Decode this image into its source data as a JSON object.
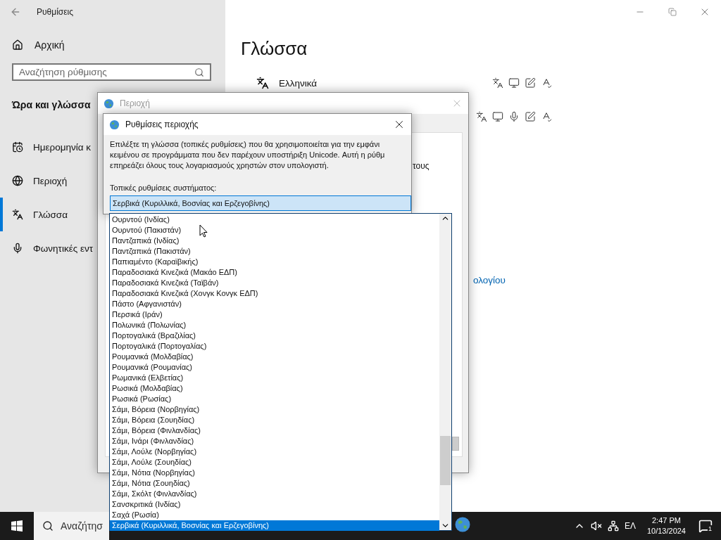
{
  "settings_window": {
    "title": "Ρυθμίσεις",
    "home": "Αρχική",
    "search": {
      "placeholder": "Αναζήτηση ρύθμισης"
    },
    "section": "Ώρα και γλώσσα",
    "nav": [
      {
        "kind": "calendar",
        "label": "Ημερομηνία κ",
        "selected": false
      },
      {
        "kind": "globe",
        "label": "Περιοχή",
        "selected": false
      },
      {
        "kind": "language",
        "label": "Γλώσσα",
        "selected": true
      },
      {
        "kind": "microphone",
        "label": "Φωνητικές εντ",
        "selected": false
      }
    ],
    "heading": "Γλώσσα",
    "languages": [
      {
        "name": "Ελληνικά",
        "features": [
          {
            "kind": "text"
          },
          {
            "kind": "display"
          },
          {
            "kind": "handwriting"
          },
          {
            "kind": "spelling"
          }
        ]
      },
      {
        "features": [
          {
            "kind": "text"
          },
          {
            "kind": "display"
          },
          {
            "kind": "speech"
          },
          {
            "kind": "handwriting"
          },
          {
            "kind": "spelling"
          }
        ]
      }
    ],
    "link": "ολογίου"
  },
  "region_dialog": {
    "title": "Περιοχή",
    "fragment": "τους"
  },
  "region_settings_dialog": {
    "title": "Ρυθμίσεις περιοχής",
    "description_lines": [
      "Επιλέξτε τη γλώσσα (τοπικές ρυθμίσεις) που θα χρησιμοποιείται για την εμφάνι",
      "κειμένου σε προγράμματα που δεν παρέχουν υποστήριξη Unicode. Αυτή η ρύθμ",
      "επηρεάζει όλους τους λογαριασμούς χρηστών στον υπολογιστή."
    ],
    "locale_label": "Τοπικές ρυθμίσεις συστήματος:",
    "locale_value": "Σερβικά (Κυριλλικά, Βοσνίας και Ερζεγοβίνης)"
  },
  "locale_list": {
    "items": [
      {
        "label": "Ουρντού (Ινδίας)",
        "selected": false
      },
      {
        "label": "Ουρντού (Πακιστάν)",
        "selected": false
      },
      {
        "label": "Παντζαπικά (Ινδίας)",
        "selected": false
      },
      {
        "label": "Παντζαπικά (Πακιστάν)",
        "selected": false
      },
      {
        "label": "Παπιαμέντο (Καραϊβικής)",
        "selected": false
      },
      {
        "label": "Παραδοσιακά Κινεζικά (Μακάο ΕΔΠ)",
        "selected": false
      },
      {
        "label": "Παραδοσιακά Κινεζικά (Ταϊβάν)",
        "selected": false
      },
      {
        "label": "Παραδοσιακά Κινεζικά (Χονγκ Κονγκ ΕΔΠ)",
        "selected": false
      },
      {
        "label": "Πάστο (Αφγανιστάν)",
        "selected": false
      },
      {
        "label": "Περσικά (Ιράν)",
        "selected": false
      },
      {
        "label": "Πολωνικά (Πολωνίας)",
        "selected": false
      },
      {
        "label": "Πορτογαλικά (Βραζιλίας)",
        "selected": false
      },
      {
        "label": "Πορτογαλικά (Πορτογαλίας)",
        "selected": false
      },
      {
        "label": "Ρουμανικά (Μολδαβίας)",
        "selected": false
      },
      {
        "label": "Ρουμανικά (Ρουμανίας)",
        "selected": false
      },
      {
        "label": "Ρωμανικά (Ελβετίας)",
        "selected": false
      },
      {
        "label": "Ρωσικά (Μολδαβίας)",
        "selected": false
      },
      {
        "label": "Ρωσικά (Ρωσίας)",
        "selected": false
      },
      {
        "label": "Σάμι, Βόρεια (Νορβηγίας)",
        "selected": false
      },
      {
        "label": "Σάμι, Βόρεια (Σουηδίας)",
        "selected": false
      },
      {
        "label": "Σάμι, Βόρεια (Φινλανδίας)",
        "selected": false
      },
      {
        "label": "Σάμι, Ινάρι (Φινλανδίας)",
        "selected": false
      },
      {
        "label": "Σάμι, Λούλε (Νορβηγίας)",
        "selected": false
      },
      {
        "label": "Σάμι, Λούλε (Σουηδίας)",
        "selected": false
      },
      {
        "label": "Σάμι, Νότια (Νορβηγίας)",
        "selected": false
      },
      {
        "label": "Σάμι, Νότια (Σουηδίας)",
        "selected": false
      },
      {
        "label": "Σάμι, Σκόλτ (Φινλανδίας)",
        "selected": false
      },
      {
        "label": "Σανσκριτικά (Ινδίας)",
        "selected": false
      },
      {
        "label": "Σαχά (Ρωσία)",
        "selected": false
      },
      {
        "label": "Σερβικά (Κυριλλικά, Βοσνίας και Ερζεγοβίνης)",
        "selected": true
      }
    ]
  },
  "taskbar": {
    "search": "Αναζήτησ",
    "language": "ΕΛ",
    "time": "2:47 PM",
    "date": "10/13/2024",
    "notifications": "1"
  }
}
